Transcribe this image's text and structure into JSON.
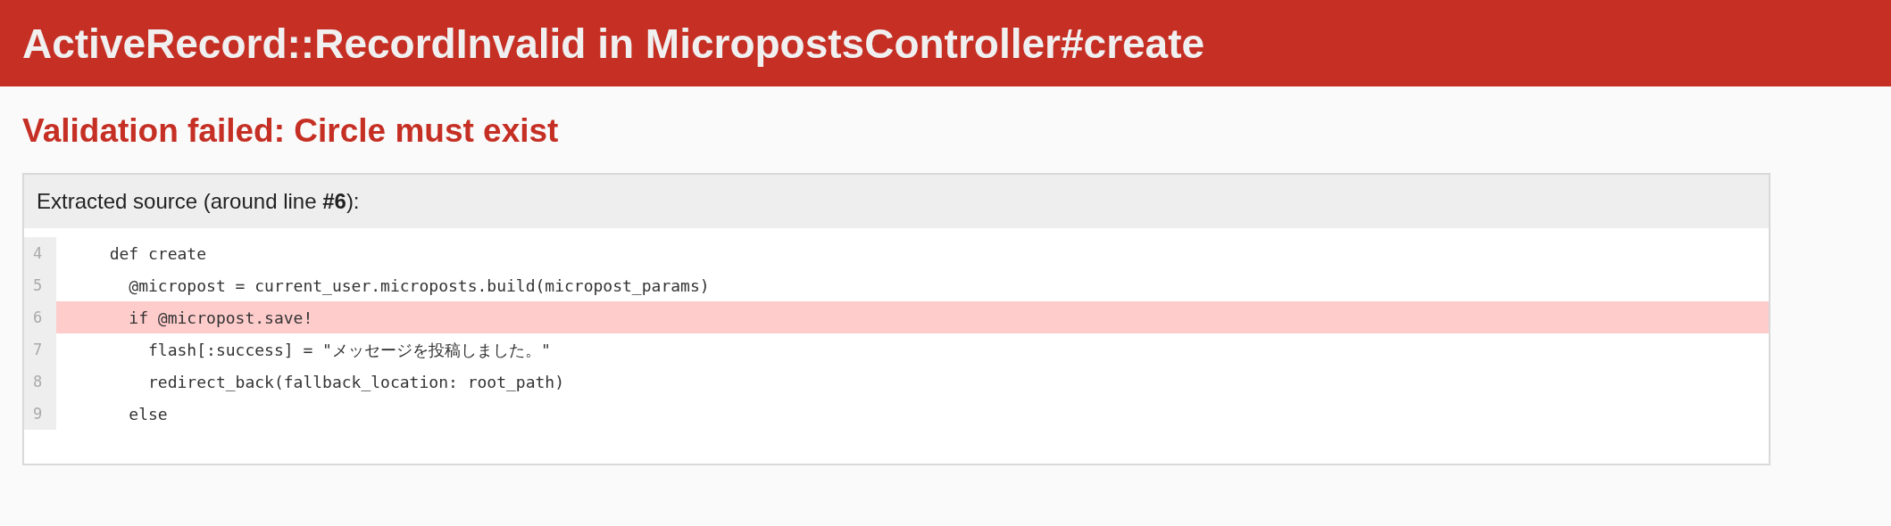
{
  "header": {
    "title": "ActiveRecord::RecordInvalid in MicropostsController#create"
  },
  "message": "Validation failed: Circle must exist",
  "source": {
    "title": "Extracted source (around line **#6**):",
    "lines": [
      {
        "number": "4",
        "code": "  def create",
        "selected": false
      },
      {
        "number": "5",
        "code": "    @micropost = current_user.microposts.build(micropost_params)",
        "selected": false
      },
      {
        "number": "6",
        "code": "    if @micropost.save!",
        "selected": true
      },
      {
        "number": "7",
        "code": "      flash[:success] = \"メッセージを投稿しました。\"",
        "selected": false
      },
      {
        "number": "8",
        "code": "      redirect_back(fallback_location: root_path)",
        "selected": false
      },
      {
        "number": "9",
        "code": "    else",
        "selected": false
      }
    ]
  }
}
